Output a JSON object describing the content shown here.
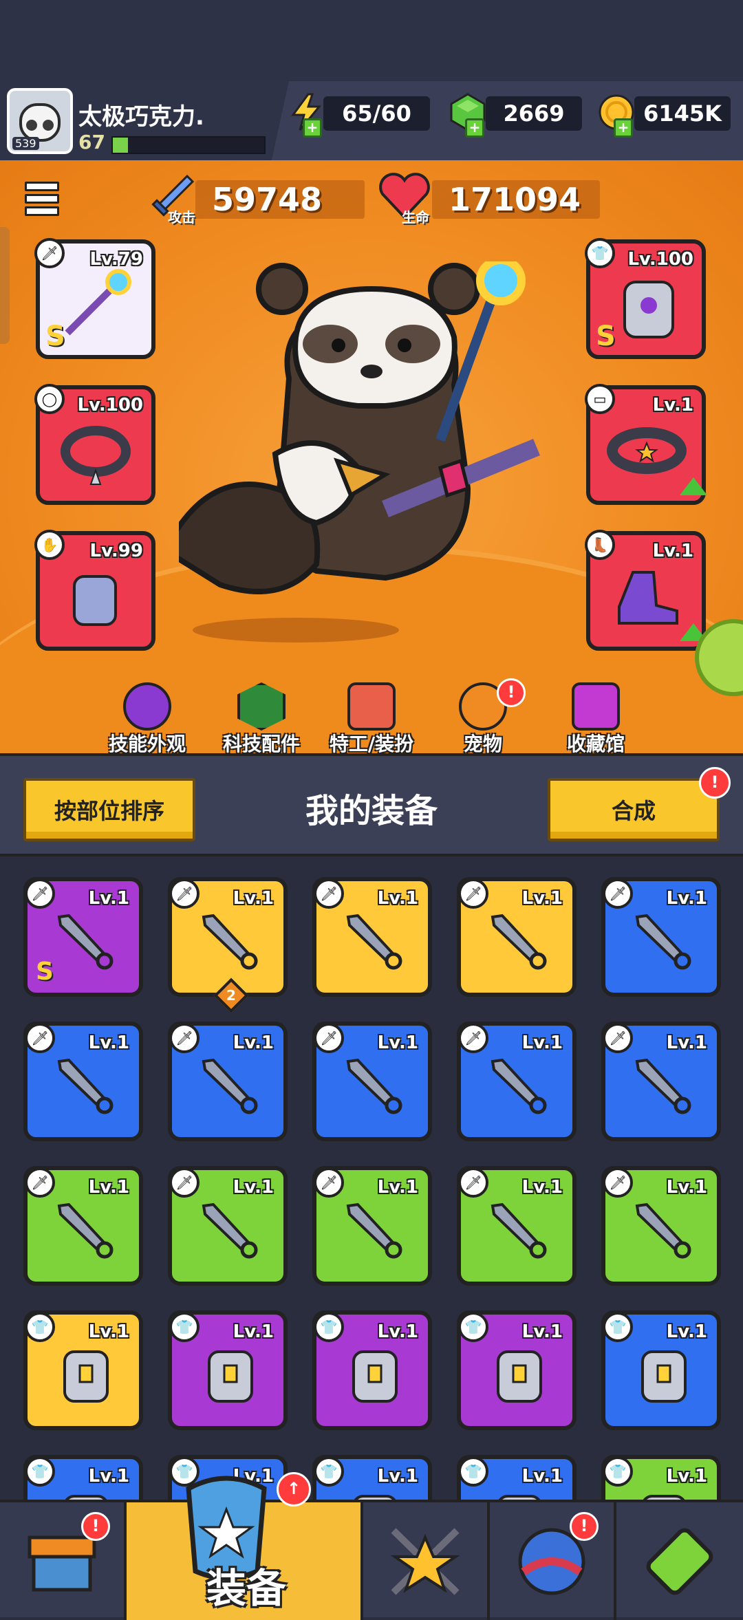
{
  "player": {
    "name": "太极巧克力.",
    "level": "67",
    "avatar_badge": "539"
  },
  "resources": {
    "energy": "65/60",
    "gems": "2669",
    "gold": "6145K"
  },
  "stats": {
    "attack_label": "攻击",
    "attack": "59748",
    "hp_label": "生命",
    "hp": "171094"
  },
  "equipped": {
    "weapon": {
      "level": "Lv.79",
      "rank": "S"
    },
    "armor": {
      "level": "Lv.100",
      "rank": "S"
    },
    "necklace": {
      "level": "Lv.100"
    },
    "belt": {
      "level": "Lv.1"
    },
    "gloves": {
      "level": "Lv.99"
    },
    "boots": {
      "level": "Lv.1"
    }
  },
  "sub_nav": [
    {
      "label": "技能外观"
    },
    {
      "label": "科技配件"
    },
    {
      "label": "特工/装扮"
    },
    {
      "label": "宠物"
    },
    {
      "label": "收藏馆"
    }
  ],
  "equipment": {
    "sort_button": "按部位排序",
    "title": "我的装备",
    "merge_button": "合成",
    "alert": "!"
  },
  "grid": [
    [
      {
        "level": "Lv.1",
        "rank": "S",
        "color": "purple",
        "icon": "sword-icon"
      },
      {
        "level": "Lv.1",
        "count": "2",
        "color": "yellow",
        "icon": "sword-icon"
      },
      {
        "level": "Lv.1",
        "color": "yellow",
        "icon": "sword-icon"
      },
      {
        "level": "Lv.1",
        "color": "yellow",
        "icon": "sword-icon"
      },
      {
        "level": "Lv.1",
        "color": "blue",
        "icon": "sword-icon"
      }
    ],
    [
      {
        "level": "Lv.1",
        "color": "blue",
        "icon": "sword-icon"
      },
      {
        "level": "Lv.1",
        "color": "blue",
        "icon": "sword-icon"
      },
      {
        "level": "Lv.1",
        "color": "blue",
        "icon": "sword-icon"
      },
      {
        "level": "Lv.1",
        "color": "blue",
        "icon": "sword-icon"
      },
      {
        "level": "Lv.1",
        "color": "blue",
        "icon": "sword-icon"
      }
    ],
    [
      {
        "level": "Lv.1",
        "color": "green",
        "icon": "sword-icon"
      },
      {
        "level": "Lv.1",
        "color": "green",
        "icon": "sword-icon"
      },
      {
        "level": "Lv.1",
        "color": "green",
        "icon": "sword-icon"
      },
      {
        "level": "Lv.1",
        "color": "green",
        "icon": "sword-icon"
      },
      {
        "level": "Lv.1",
        "color": "green",
        "icon": "sword-icon"
      }
    ],
    [
      {
        "level": "Lv.1",
        "color": "yellow",
        "icon": "shirt-icon"
      },
      {
        "level": "Lv.1",
        "color": "purple",
        "icon": "shirt-icon"
      },
      {
        "level": "Lv.1",
        "color": "purple",
        "icon": "shirt-icon"
      },
      {
        "level": "Lv.1",
        "color": "purple",
        "icon": "shirt-icon"
      },
      {
        "level": "Lv.1",
        "color": "blue",
        "icon": "shirt-icon"
      }
    ],
    [
      {
        "level": "Lv.1",
        "color": "blue",
        "icon": "shirt-icon"
      },
      {
        "level": "Lv.1",
        "color": "blue",
        "icon": "shirt-icon"
      },
      {
        "level": "Lv.1",
        "color": "blue",
        "icon": "shirt-icon"
      },
      {
        "level": "Lv.1",
        "color": "blue",
        "icon": "shirt-icon"
      },
      {
        "level": "Lv.1",
        "color": "green",
        "icon": "shirt-icon"
      }
    ]
  ],
  "bottom_nav": {
    "active_label": "装备"
  }
}
